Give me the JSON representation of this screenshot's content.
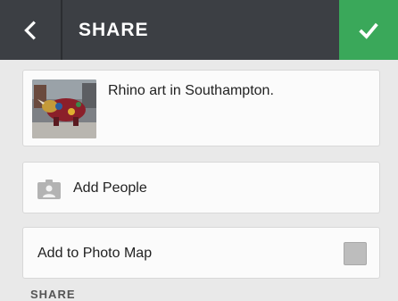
{
  "header": {
    "title": "SHARE",
    "back_icon": "chevron-left-icon",
    "confirm_icon": "checkmark-icon",
    "confirm_color": "#3aa85a",
    "bar_color": "#3c3f44"
  },
  "post": {
    "caption": "Rhino art in Southampton.",
    "thumbnail_icon": "photo-thumbnail"
  },
  "people": {
    "label": "Add People",
    "icon": "person-tag-icon"
  },
  "photo_map": {
    "label": "Add to Photo Map",
    "checked": false
  },
  "section": {
    "label": "SHARE"
  }
}
